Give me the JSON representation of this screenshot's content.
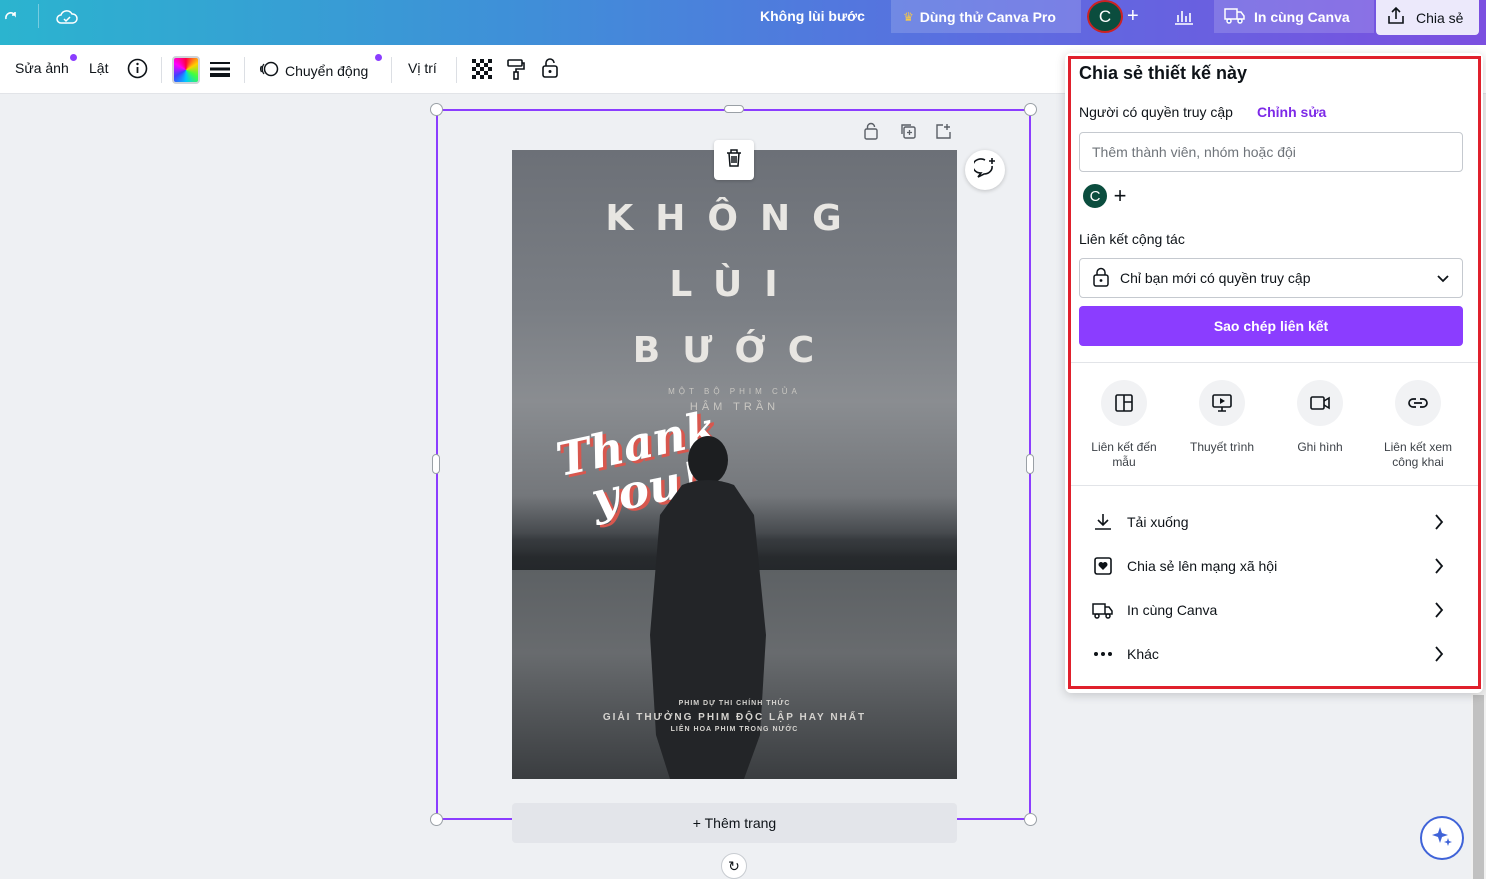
{
  "topbar": {
    "document_title": "Không lùi bước",
    "pro_label": "Dùng thử Canva Pro",
    "avatar_letter": "C",
    "print_label": "In cùng Canva",
    "share_label": "Chia sẻ",
    "icons": [
      "redo-icon",
      "cloud-sync-icon",
      "crown-icon",
      "add-icon",
      "chart-icon",
      "truck-icon",
      "share-upload-icon"
    ]
  },
  "toolbar": {
    "edit_photo": "Sửa ảnh",
    "flip": "Lật",
    "animate": "Chuyển động",
    "position": "Vị trí",
    "accent_dot_color": "#8b3dff"
  },
  "poster": {
    "title_lines": [
      "KHÔNG",
      "LÙI",
      "BƯỚC"
    ],
    "subtitle_1": "MỘT BỘ PHIM CỦA",
    "subtitle_2": "HÂM TRẦN",
    "thanks_1": "Thank",
    "thanks_2": "you!",
    "credit_1": "PHIM DỰ THI CHÍNH THỨC",
    "credit_2": "GIẢI THƯỞNG PHIM ĐỘC LẬP HAY NHẤT",
    "credit_3": "LIÊN HOA PHIM TRONG NƯỚC"
  },
  "canvas": {
    "add_page": "+ Thêm trang"
  },
  "share_panel": {
    "title": "Chia sẻ thiết kế này",
    "access_label": "Người có quyền truy cập",
    "edit_link": "Chỉnh sửa",
    "invite_placeholder": "Thêm thành viên, nhóm hoặc đội",
    "member_letter": "C",
    "collab_link_label": "Liên kết cộng tác",
    "access_option": "Chỉ bạn mới có quyền truy cập",
    "copy_link": "Sao chép liên kết",
    "options": [
      {
        "line1": "Liên kết đến",
        "line2": "mẫu",
        "icon": "template-icon"
      },
      {
        "line1": "Thuyết trình",
        "line2": "",
        "icon": "present-icon"
      },
      {
        "line1": "Ghi hình",
        "line2": "",
        "icon": "record-icon"
      },
      {
        "line1": "Liên kết xem",
        "line2": "công khai",
        "icon": "link-icon"
      }
    ],
    "rows": [
      {
        "label": "Tải xuống",
        "icon": "download-icon"
      },
      {
        "label": "Chia sẻ lên mạng xã hội",
        "icon": "social-heart-icon"
      },
      {
        "label": "In cùng Canva",
        "icon": "truck-icon"
      },
      {
        "label": "Khác",
        "icon": "more-icon"
      }
    ],
    "brand_color": "#8b3dff",
    "highlight_color": "#e0202c"
  }
}
